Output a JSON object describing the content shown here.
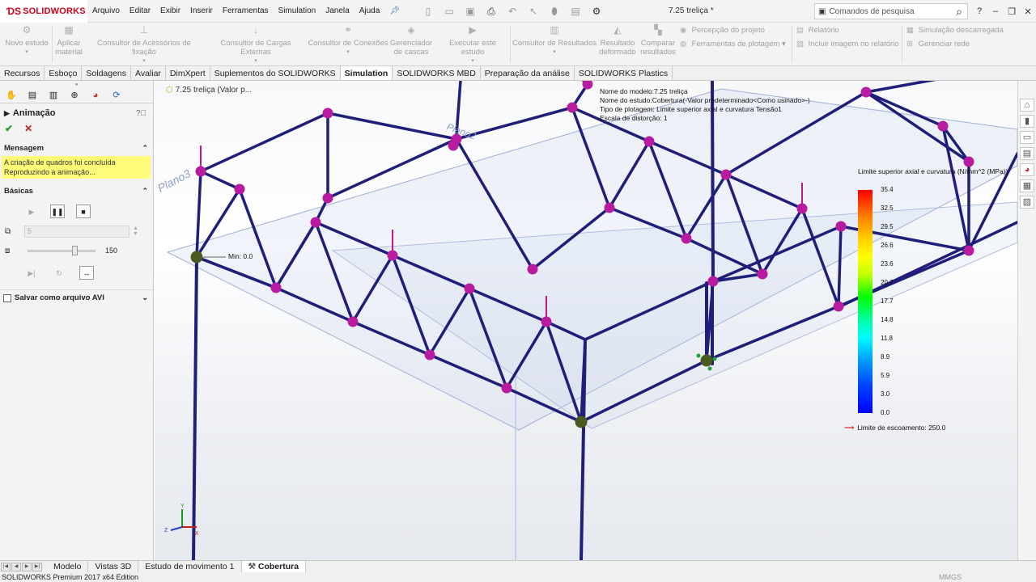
{
  "app": {
    "logo_text": "SOLIDWORKS",
    "document_title": "7.25 treliça *"
  },
  "menu": [
    "Arquivo",
    "Editar",
    "Exibir",
    "Inserir",
    "Ferramentas",
    "Simulation",
    "Janela",
    "Ajuda"
  ],
  "search": {
    "placeholder": "Comandos de pesquisa"
  },
  "ribbon": {
    "new_study": "Novo estudo",
    "apply_material": [
      "Aplicar",
      "material"
    ],
    "fixtures_advisor": "Consultor de Acessórios de fixação",
    "loads_advisor": "Consultor de Cargas Externas",
    "connections_advisor": "Consultor de Conexões",
    "shell_manager": [
      "Gerenciador",
      "de cascas"
    ],
    "run_study": "Executar este estudo",
    "results_advisor": "Consultor de Resultados",
    "deformed_result": [
      "Resultado",
      "deformado"
    ],
    "compare_results": [
      "Comparar",
      "resultados"
    ],
    "design_insight": "Percepção do projeto",
    "plot_tools": "Ferramentas de plotagem",
    "report": "Relatório",
    "include_image": "Incluir imagem no relatório",
    "offloaded_simulation": "Simulação descarregada",
    "manage_network": "Gerenciar rede"
  },
  "tabs": [
    {
      "label": "Recursos",
      "active": false
    },
    {
      "label": "Esboço",
      "active": false
    },
    {
      "label": "Soldagens",
      "active": false
    },
    {
      "label": "Avaliar",
      "active": false
    },
    {
      "label": "DimXpert",
      "active": false
    },
    {
      "label": "Suplementos do SOLIDWORKS",
      "active": false
    },
    {
      "label": "Simulation",
      "active": true
    },
    {
      "label": "SOLIDWORKS MBD",
      "active": false
    },
    {
      "label": "Preparação da análise",
      "active": false
    },
    {
      "label": "SOLIDWORKS Plastics",
      "active": false
    }
  ],
  "property_manager": {
    "title": "Animação",
    "message_header": "Mensagem",
    "message_lines": [
      "A criação de quadros foi concluída",
      "Reproduzindo a animação..."
    ],
    "basics_header": "Básicas",
    "frames_value": "5",
    "speed_value": "150",
    "speed_fraction": 0.72,
    "save_avi_label": "Salvar como arquivo AVI"
  },
  "tree": {
    "node_label": "7.25 treliça  (Valor p..."
  },
  "study_info": [
    "Nome do modelo:7.25 treliça",
    "Nome do estudo:Cobertura(-Valor predeterminado<Como usinado>-)",
    "Tipo de plotagem: Limite superior axial e curvatura Tensão1",
    "Escala de distorção: 1"
  ],
  "legend": {
    "title": "Limite superior axial e curvatura (N/mm^2 (MPa))",
    "values": [
      "35.4",
      "32.5",
      "29.5",
      "26.6",
      "23.6",
      "20.7",
      "17.7",
      "14.8",
      "11.8",
      "8.9",
      "5.9",
      "3.0",
      "0.0"
    ],
    "yield_label": "Limite de escoamento: 250.0"
  },
  "min_label": "Min: 0.0",
  "plane_labels": [
    "Plano3",
    "Plano2"
  ],
  "triad_axes": [
    "Y",
    "Z",
    "X"
  ],
  "bottom_tabs": [
    {
      "label": "Modelo",
      "active": false
    },
    {
      "label": "Vistas 3D",
      "active": false
    },
    {
      "label": "Estudo de movimento 1",
      "active": false
    },
    {
      "label": "Cobertura",
      "active": true
    }
  ],
  "status": {
    "edition": "SOLIDWORKS Premium 2017 x64 Edition",
    "units": "MMGS"
  },
  "colors": {
    "member": "#1f1f7a",
    "node": "#b81aa0",
    "support_node": "#4a5a20",
    "accent": "#d0021b"
  }
}
